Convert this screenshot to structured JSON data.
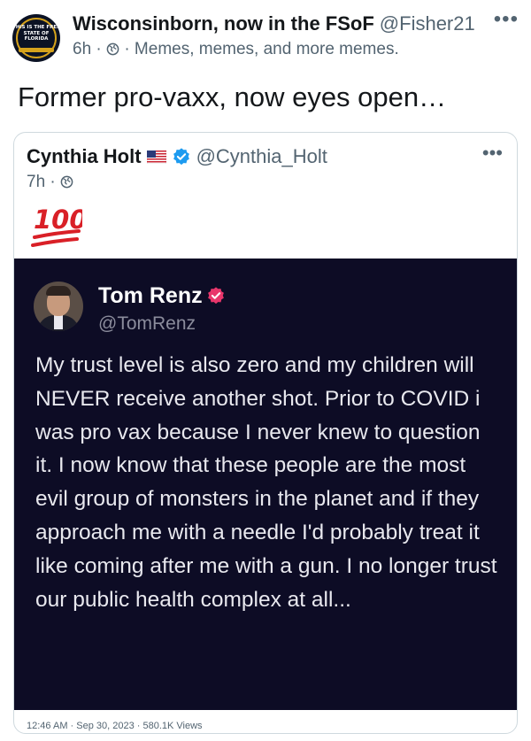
{
  "post": {
    "author_name": "Wisconsinborn, now in the FSoF",
    "author_handle": "@Fisher21",
    "time": "6h",
    "separator": "·",
    "community": "Memes, memes, and more memes.",
    "text": "Former pro-vaxx, now eyes open…",
    "avatar_text": "THIS IS THE FREE STATE OF FLORIDA",
    "more_icon": "more-icon"
  },
  "quote": {
    "author_name": "Cynthia Holt",
    "author_handle": "@Cynthia_Holt",
    "time": "7h",
    "separator": "·",
    "emoji_icon": "hundred-points-icon",
    "footer": "12:46 AM · Sep 30, 2023 · 580.1K Views"
  },
  "embedded": {
    "name": "Tom Renz",
    "handle": "@TomRenz",
    "body": "My trust level is also zero and my children will NEVER receive another shot. Prior to COVID i was pro vax because I never knew to question it. I now know that these people are the most evil group of monsters in the planet and if they approach me with a needle I'd probably treat it like coming after me with a gun. I no longer trust our public health complex at all..."
  },
  "colors": {
    "text_primary": "#14171a",
    "text_secondary": "#536471",
    "verified_blue": "#1d9bf0",
    "embedded_bg": "#0d0c25",
    "badge_pink": "#e8366b",
    "hundred_red": "#d92027"
  }
}
